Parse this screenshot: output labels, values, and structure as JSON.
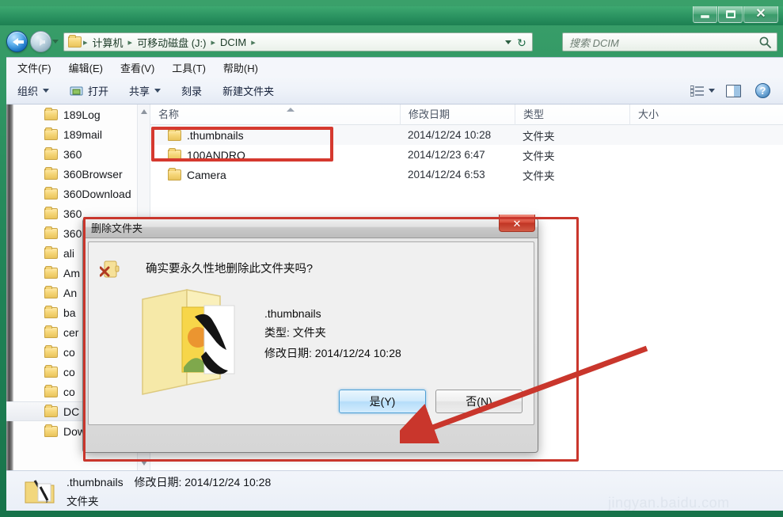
{
  "window": {
    "controls": {
      "minimize": "–",
      "maximize": "□",
      "close": "✕"
    }
  },
  "nav": {
    "back_label": "后退",
    "forward_label": "前进",
    "history_label": "最近浏览的位置",
    "breadcrumbs": [
      "计算机",
      "可移动磁盘 (J:)",
      "DCIM"
    ],
    "separator": "▸",
    "refresh_label": "↻"
  },
  "search": {
    "placeholder": "搜索 DCIM",
    "icon": "search-icon"
  },
  "menubar": {
    "items": [
      "文件(F)",
      "编辑(E)",
      "查看(V)",
      "工具(T)",
      "帮助(H)"
    ]
  },
  "toolbar": {
    "organize": "组织",
    "open": "打开",
    "share": "共享",
    "burn": "刻录",
    "new_folder": "新建文件夹",
    "help_glyph": "?"
  },
  "nav_pane": {
    "items": [
      "189Log",
      "189mail",
      "360",
      "360Browser",
      "360Download",
      "360",
      "360",
      "ali",
      "Am",
      "An",
      "ba",
      "cer",
      "co",
      "co",
      "co",
      "DC",
      "Download"
    ],
    "selected_index": 15
  },
  "file_list": {
    "columns": [
      "名称",
      "修改日期",
      "类型",
      "大小"
    ],
    "rows": [
      {
        "name": ".thumbnails",
        "date": "2014/12/24 10:28",
        "type": "文件夹",
        "size": ""
      },
      {
        "name": "100ANDRO",
        "date": "2014/12/23 6:47",
        "type": "文件夹",
        "size": ""
      },
      {
        "name": "Camera",
        "date": "2014/12/24 6:53",
        "type": "文件夹",
        "size": ""
      }
    ]
  },
  "status": {
    "name": ".thumbnails",
    "date_label": "修改日期: 2014/12/24 10:28",
    "type": "文件夹"
  },
  "dialog": {
    "title": "删除文件夹",
    "close_glyph": "✕",
    "question": "确实要永久性地删除此文件夹吗?",
    "item_name": ".thumbnails",
    "item_type": "类型: 文件夹",
    "item_date": "修改日期: 2014/12/24 10:28",
    "yes_label": "是(Y)",
    "no_label": "否(N)"
  },
  "watermark": {
    "text": "jingyan.baidu.com"
  },
  "colors": {
    "accent_green": "#23875a",
    "annotation_red": "#d5392f",
    "folder_yellow": "#f5d678",
    "dialog_primary_blue": "#b5ddfa"
  }
}
